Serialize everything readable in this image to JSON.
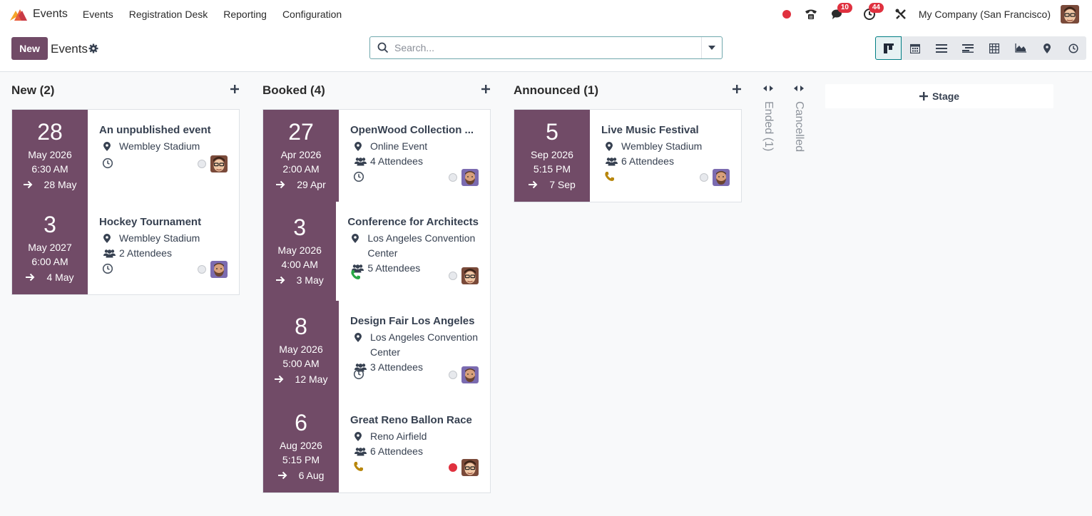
{
  "navbar": {
    "app_name": "Events",
    "menu": [
      "Events",
      "Registration Desk",
      "Reporting",
      "Configuration"
    ],
    "messages_count": "10",
    "activities_count": "44",
    "company": "My Company (San Francisco)"
  },
  "control": {
    "new_label": "New",
    "title": "Events",
    "search_placeholder": "Search...",
    "views": [
      "kanban",
      "calendar",
      "list",
      "gantt",
      "pivot",
      "graph",
      "map",
      "activity"
    ],
    "active_view": "kanban"
  },
  "columns": [
    {
      "title": "New (2)",
      "cards": [
        {
          "day": "28",
          "month_year": "May 2026",
          "time": "6:30 AM",
          "end": "28 May",
          "title": "An unpublished event",
          "location": "Wembley Stadium",
          "attendees": "",
          "activity": "clock",
          "priority": "normal",
          "avatar": "glasses"
        },
        {
          "day": "3",
          "month_year": "May 2027",
          "time": "6:00 AM",
          "end": "4 May",
          "title": "Hockey Tournament",
          "location": "Wembley Stadium",
          "attendees": "2 Attendees",
          "activity": "clock",
          "priority": "normal",
          "avatar": "beard"
        }
      ]
    },
    {
      "title": "Booked (4)",
      "cards": [
        {
          "day": "27",
          "month_year": "Apr 2026",
          "time": "2:00 AM",
          "end": "29 Apr",
          "title": "OpenWood Collection ...",
          "location": "Online Event",
          "attendees": "4 Attendees",
          "activity": "clock",
          "priority": "normal",
          "avatar": "beard"
        },
        {
          "day": "3",
          "month_year": "May 2026",
          "time": "4:00 AM",
          "end": "3 May",
          "title": "Conference for Architects",
          "location": "Los Angeles Convention Center",
          "attendees": "5 Attendees",
          "activity": "phone-green",
          "priority": "normal",
          "avatar": "glasses"
        },
        {
          "day": "8",
          "month_year": "May 2026",
          "time": "5:00 AM",
          "end": "12 May",
          "title": "Design Fair Los Angeles",
          "location": "Los Angeles Convention Center",
          "attendees": "3 Attendees",
          "activity": "clock",
          "priority": "normal",
          "avatar": "beard"
        },
        {
          "day": "6",
          "month_year": "Aug 2026",
          "time": "5:15 PM",
          "end": "6 Aug",
          "title": "Great Reno Ballon Race",
          "location": "Reno Airfield",
          "attendees": "6 Attendees",
          "activity": "phone-orange",
          "priority": "red",
          "avatar": "glasses"
        }
      ]
    },
    {
      "title": "Announced (1)",
      "cards": [
        {
          "day": "5",
          "month_year": "Sep 2026",
          "time": "5:15 PM",
          "end": "7 Sep",
          "title": "Live Music Festival",
          "location": "Wembley Stadium",
          "attendees": "6 Attendees",
          "activity": "phone-orange",
          "priority": "normal",
          "avatar": "beard"
        }
      ]
    }
  ],
  "folded": [
    {
      "label": "Ended (1)"
    },
    {
      "label": "Cancelled"
    }
  ],
  "add_stage_label": "Stage",
  "colors": {
    "brand": "#714b67",
    "accent": "#017e84",
    "danger": "#e0313f"
  }
}
